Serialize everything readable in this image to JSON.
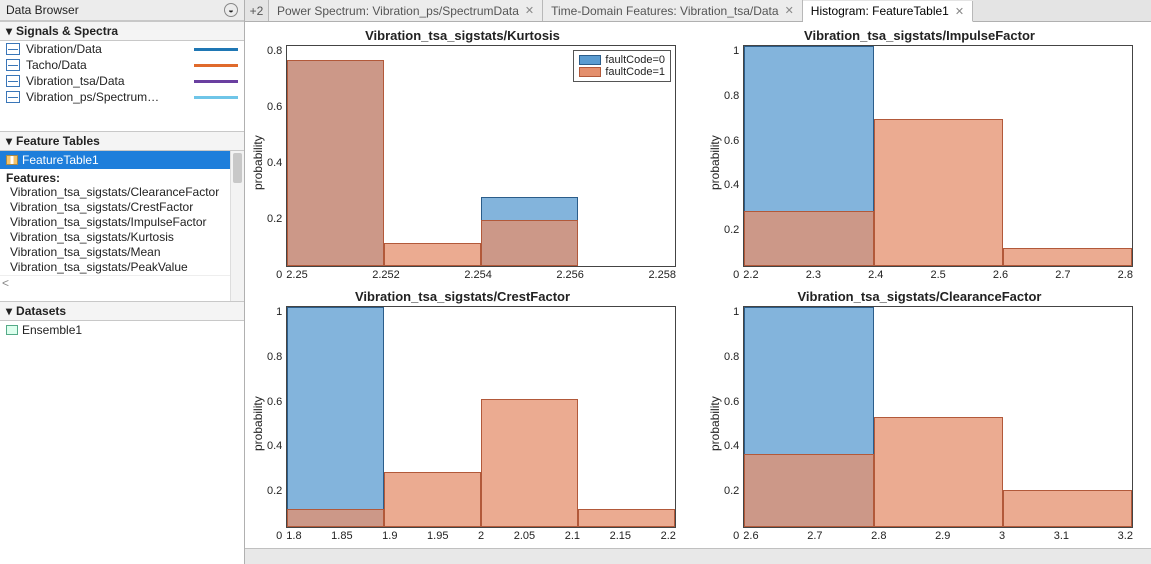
{
  "sidebar": {
    "title": "Data Browser",
    "sections": {
      "signals": {
        "header": "Signals & Spectra",
        "items": [
          {
            "name": "Vibration/Data",
            "color": "#1f77b4"
          },
          {
            "name": "Tacho/Data",
            "color": "#e06a2b"
          },
          {
            "name": "Vibration_tsa/Data",
            "color": "#6a3fa0"
          },
          {
            "name": "Vibration_ps/Spectrum…",
            "color": "#6fc5e8"
          }
        ]
      },
      "feature_tables": {
        "header": "Feature Tables",
        "selected": "FeatureTable1",
        "features_label": "Features:",
        "features": [
          "Vibration_tsa_sigstats/ClearanceFactor",
          "Vibration_tsa_sigstats/CrestFactor",
          "Vibration_tsa_sigstats/ImpulseFactor",
          "Vibration_tsa_sigstats/Kurtosis",
          "Vibration_tsa_sigstats/Mean",
          "Vibration_tsa_sigstats/PeakValue"
        ]
      },
      "datasets": {
        "header": "Datasets",
        "items": [
          "Ensemble1"
        ]
      }
    }
  },
  "tabs": {
    "plus": "+2",
    "items": [
      {
        "label": "Power Spectrum: Vibration_ps/SpectrumData",
        "active": false
      },
      {
        "label": "Time-Domain Features: Vibration_tsa/Data",
        "active": false
      },
      {
        "label": "Histogram: FeatureTable1",
        "active": true
      }
    ]
  },
  "legend": {
    "series": [
      {
        "label": "faultCode=0",
        "fill": "#5a9bd0",
        "edge": "#2b5d8a"
      },
      {
        "label": "faultCode=1",
        "fill": "#e48f6c",
        "edge": "#b2593a"
      }
    ]
  },
  "chart_data": [
    {
      "type": "bar",
      "title": "Vibration_tsa_sigstats/Kurtosis",
      "ylabel": "probability",
      "xticks": [
        "2.25",
        "2.252",
        "2.254",
        "2.256",
        "2.258"
      ],
      "yticks": [
        "0",
        "0.2",
        "0.4",
        "0.6",
        "0.8"
      ],
      "ylim": [
        0,
        0.8
      ],
      "xlim": [
        2.249,
        2.259
      ],
      "bin_edges": [
        2.249,
        2.2515,
        2.254,
        2.2565,
        2.259
      ],
      "series": [
        {
          "name": "faultCode=0",
          "values": [
            0.75,
            0.0,
            0.25,
            0.0
          ]
        },
        {
          "name": "faultCode=1",
          "values": [
            0.75,
            0.083,
            0.167,
            0.0
          ]
        }
      ],
      "show_legend": true
    },
    {
      "type": "bar",
      "title": "Vibration_tsa_sigstats/ImpulseFactor",
      "ylabel": "probability",
      "xticks": [
        "2.2",
        "2.3",
        "2.4",
        "2.5",
        "2.6",
        "2.7",
        "2.8"
      ],
      "yticks": [
        "0",
        "0.2",
        "0.4",
        "0.6",
        "0.8",
        "1"
      ],
      "ylim": [
        0,
        1
      ],
      "xlim": [
        2.2,
        2.8
      ],
      "bin_edges": [
        2.2,
        2.4,
        2.6,
        2.8
      ],
      "series": [
        {
          "name": "faultCode=0",
          "values": [
            1.0,
            0.0,
            0.0
          ]
        },
        {
          "name": "faultCode=1",
          "values": [
            0.25,
            0.667,
            0.083
          ]
        }
      ],
      "show_legend": false
    },
    {
      "type": "bar",
      "title": "Vibration_tsa_sigstats/CrestFactor",
      "ylabel": "probability",
      "xticks": [
        "1.8",
        "1.85",
        "1.9",
        "1.95",
        "2",
        "2.05",
        "2.1",
        "2.15",
        "2.2"
      ],
      "yticks": [
        "0",
        "0.2",
        "0.4",
        "0.6",
        "0.8",
        "1"
      ],
      "ylim": [
        0,
        1
      ],
      "xlim": [
        1.8,
        2.2
      ],
      "bin_edges": [
        1.8,
        1.9,
        2.0,
        2.1,
        2.2
      ],
      "series": [
        {
          "name": "faultCode=0",
          "values": [
            1.0,
            0.0,
            0.0,
            0.0
          ]
        },
        {
          "name": "faultCode=1",
          "values": [
            0.083,
            0.25,
            0.583,
            0.083
          ]
        }
      ],
      "show_legend": false
    },
    {
      "type": "bar",
      "title": "Vibration_tsa_sigstats/ClearanceFactor",
      "ylabel": "probability",
      "xticks": [
        "2.6",
        "2.7",
        "2.8",
        "2.9",
        "3",
        "3.1",
        "3.2"
      ],
      "yticks": [
        "0",
        "0.2",
        "0.4",
        "0.6",
        "0.8",
        "1"
      ],
      "ylim": [
        0,
        1
      ],
      "xlim": [
        2.6,
        3.2
      ],
      "bin_edges": [
        2.6,
        2.8,
        3.0,
        3.2
      ],
      "series": [
        {
          "name": "faultCode=0",
          "values": [
            1.0,
            0.0,
            0.0
          ]
        },
        {
          "name": "faultCode=1",
          "values": [
            0.333,
            0.5,
            0.167
          ]
        }
      ],
      "show_legend": false
    }
  ]
}
